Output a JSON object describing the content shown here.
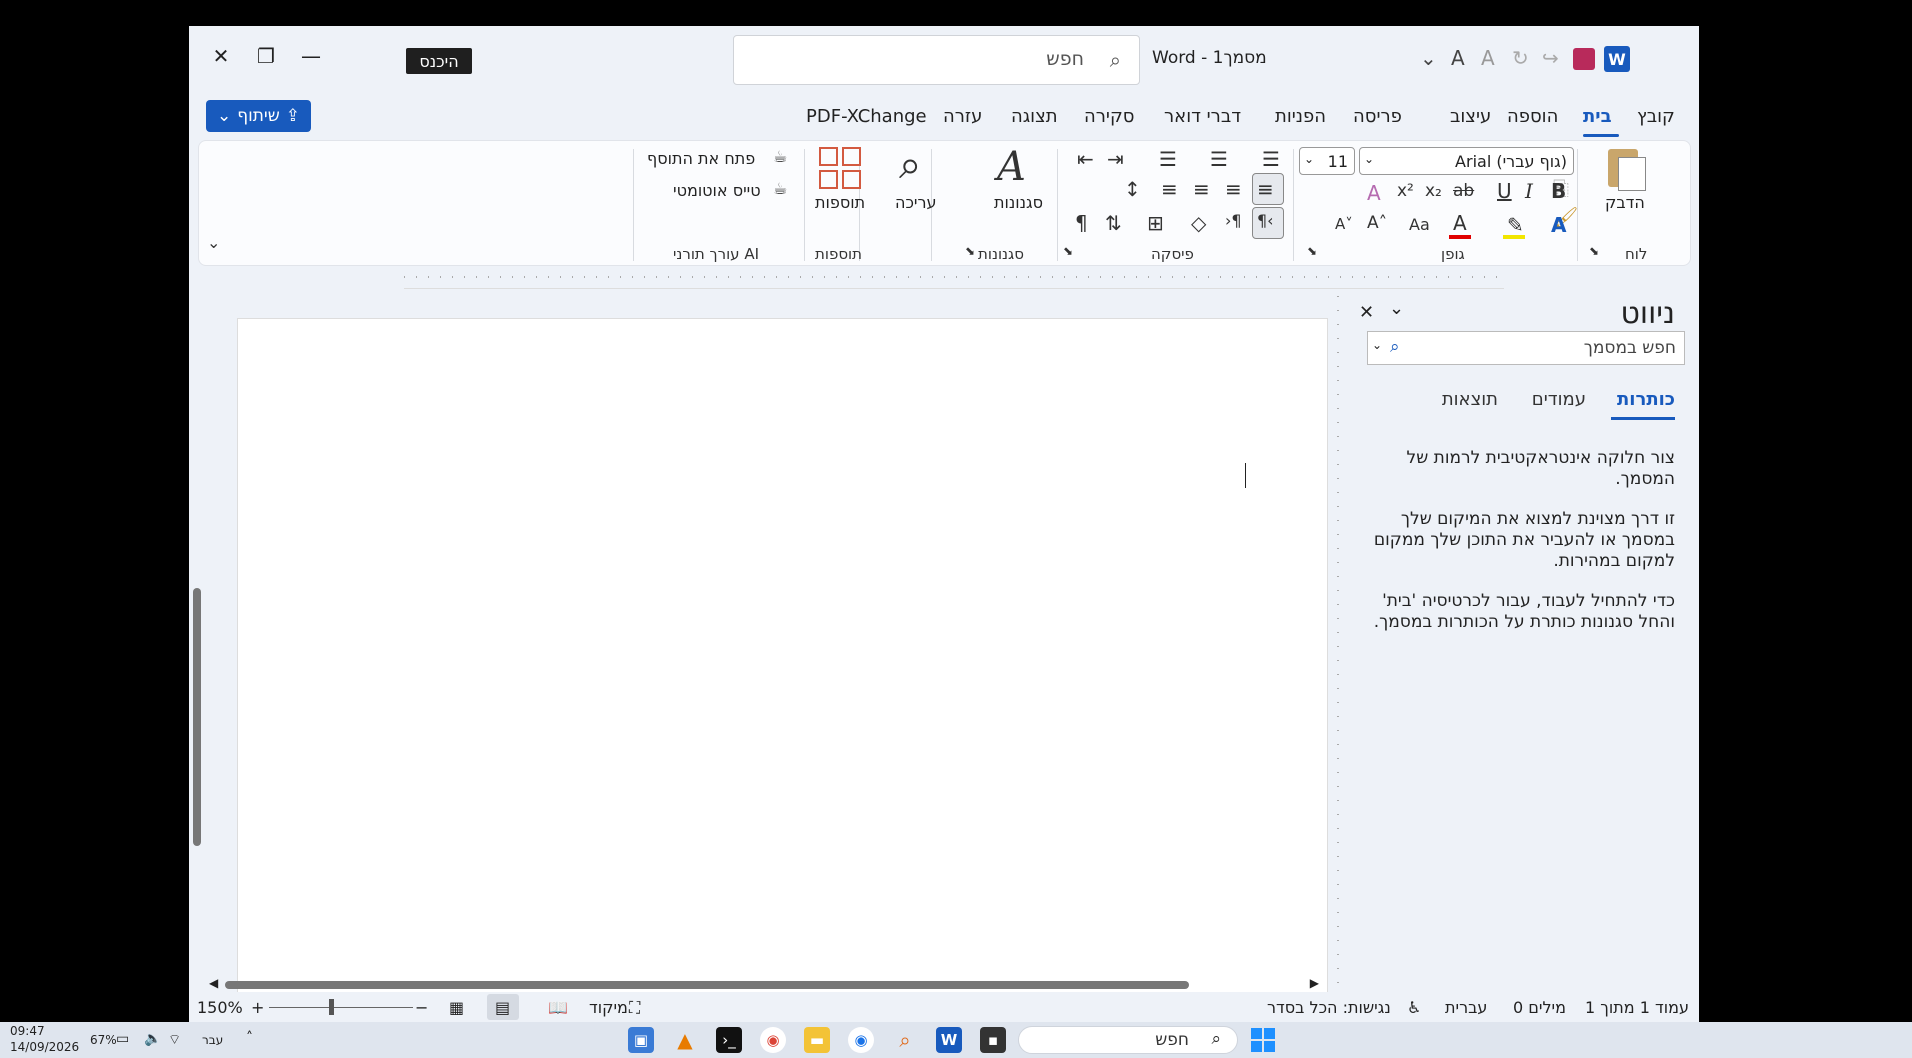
{
  "window": {
    "doc_title": "Word  -  מסמך1",
    "enter_label": "היכנס",
    "search_placeholder": "חפש"
  },
  "menu": {
    "items": [
      "קובץ",
      "בית",
      "הוספה",
      "עיצוב",
      "פריסה",
      "הפניות",
      "דברי דואר",
      "סקירה",
      "תצוגה",
      "עזרה",
      "PDF-XChange"
    ],
    "active": "בית",
    "share_label": "שיתוף"
  },
  "ribbon": {
    "groups": {
      "clipboard": "לוח",
      "font": "גופן",
      "paragraph": "פיסקה",
      "styles": "סגנונות",
      "addins": "תוספות",
      "ai": "עורך תורני AI"
    },
    "paste_label": "הדבק",
    "font_name": "Arial (גוף עברי)",
    "font_size": "11",
    "styles_label": "סגנונות",
    "editing_label": "עריכה",
    "addins_label": "תוספות",
    "open_addin": "פתח את התוסף",
    "auto_draft": "טייס אוטומטי"
  },
  "nav_pane": {
    "title": "ניווט",
    "search_placeholder": "חפש במסמך",
    "tabs": [
      "כותרות",
      "עמודים",
      "תוצאות"
    ],
    "active_tab": "כותרות",
    "text1": "צור חלוקה אינטראקטיבית לרמות של המסמך.",
    "text2": "זו דרך מצוינת למצוא את המיקום שלך במסמך או להעביר את התוכן שלך ממקום למקום במהירות.",
    "text3": "כדי להתחיל לעבוד, עבור לכרטיסיה 'בית' והחל סגנונות כותרת על הכותרות במסמך."
  },
  "status": {
    "page": "עמוד 1 מתוך 1",
    "words": "0 מילים",
    "language": "עברית",
    "accessibility": "נגישות: הכל בסדר",
    "focus": "מיקוד",
    "zoom": "150%"
  },
  "taskbar": {
    "search_placeholder": "חפש",
    "lang": "עבר",
    "battery": "67%",
    "time": "09:47",
    "date": "14/09/2026"
  },
  "colors": {
    "accent": "#185abd",
    "window_bg": "#eef2f8"
  }
}
